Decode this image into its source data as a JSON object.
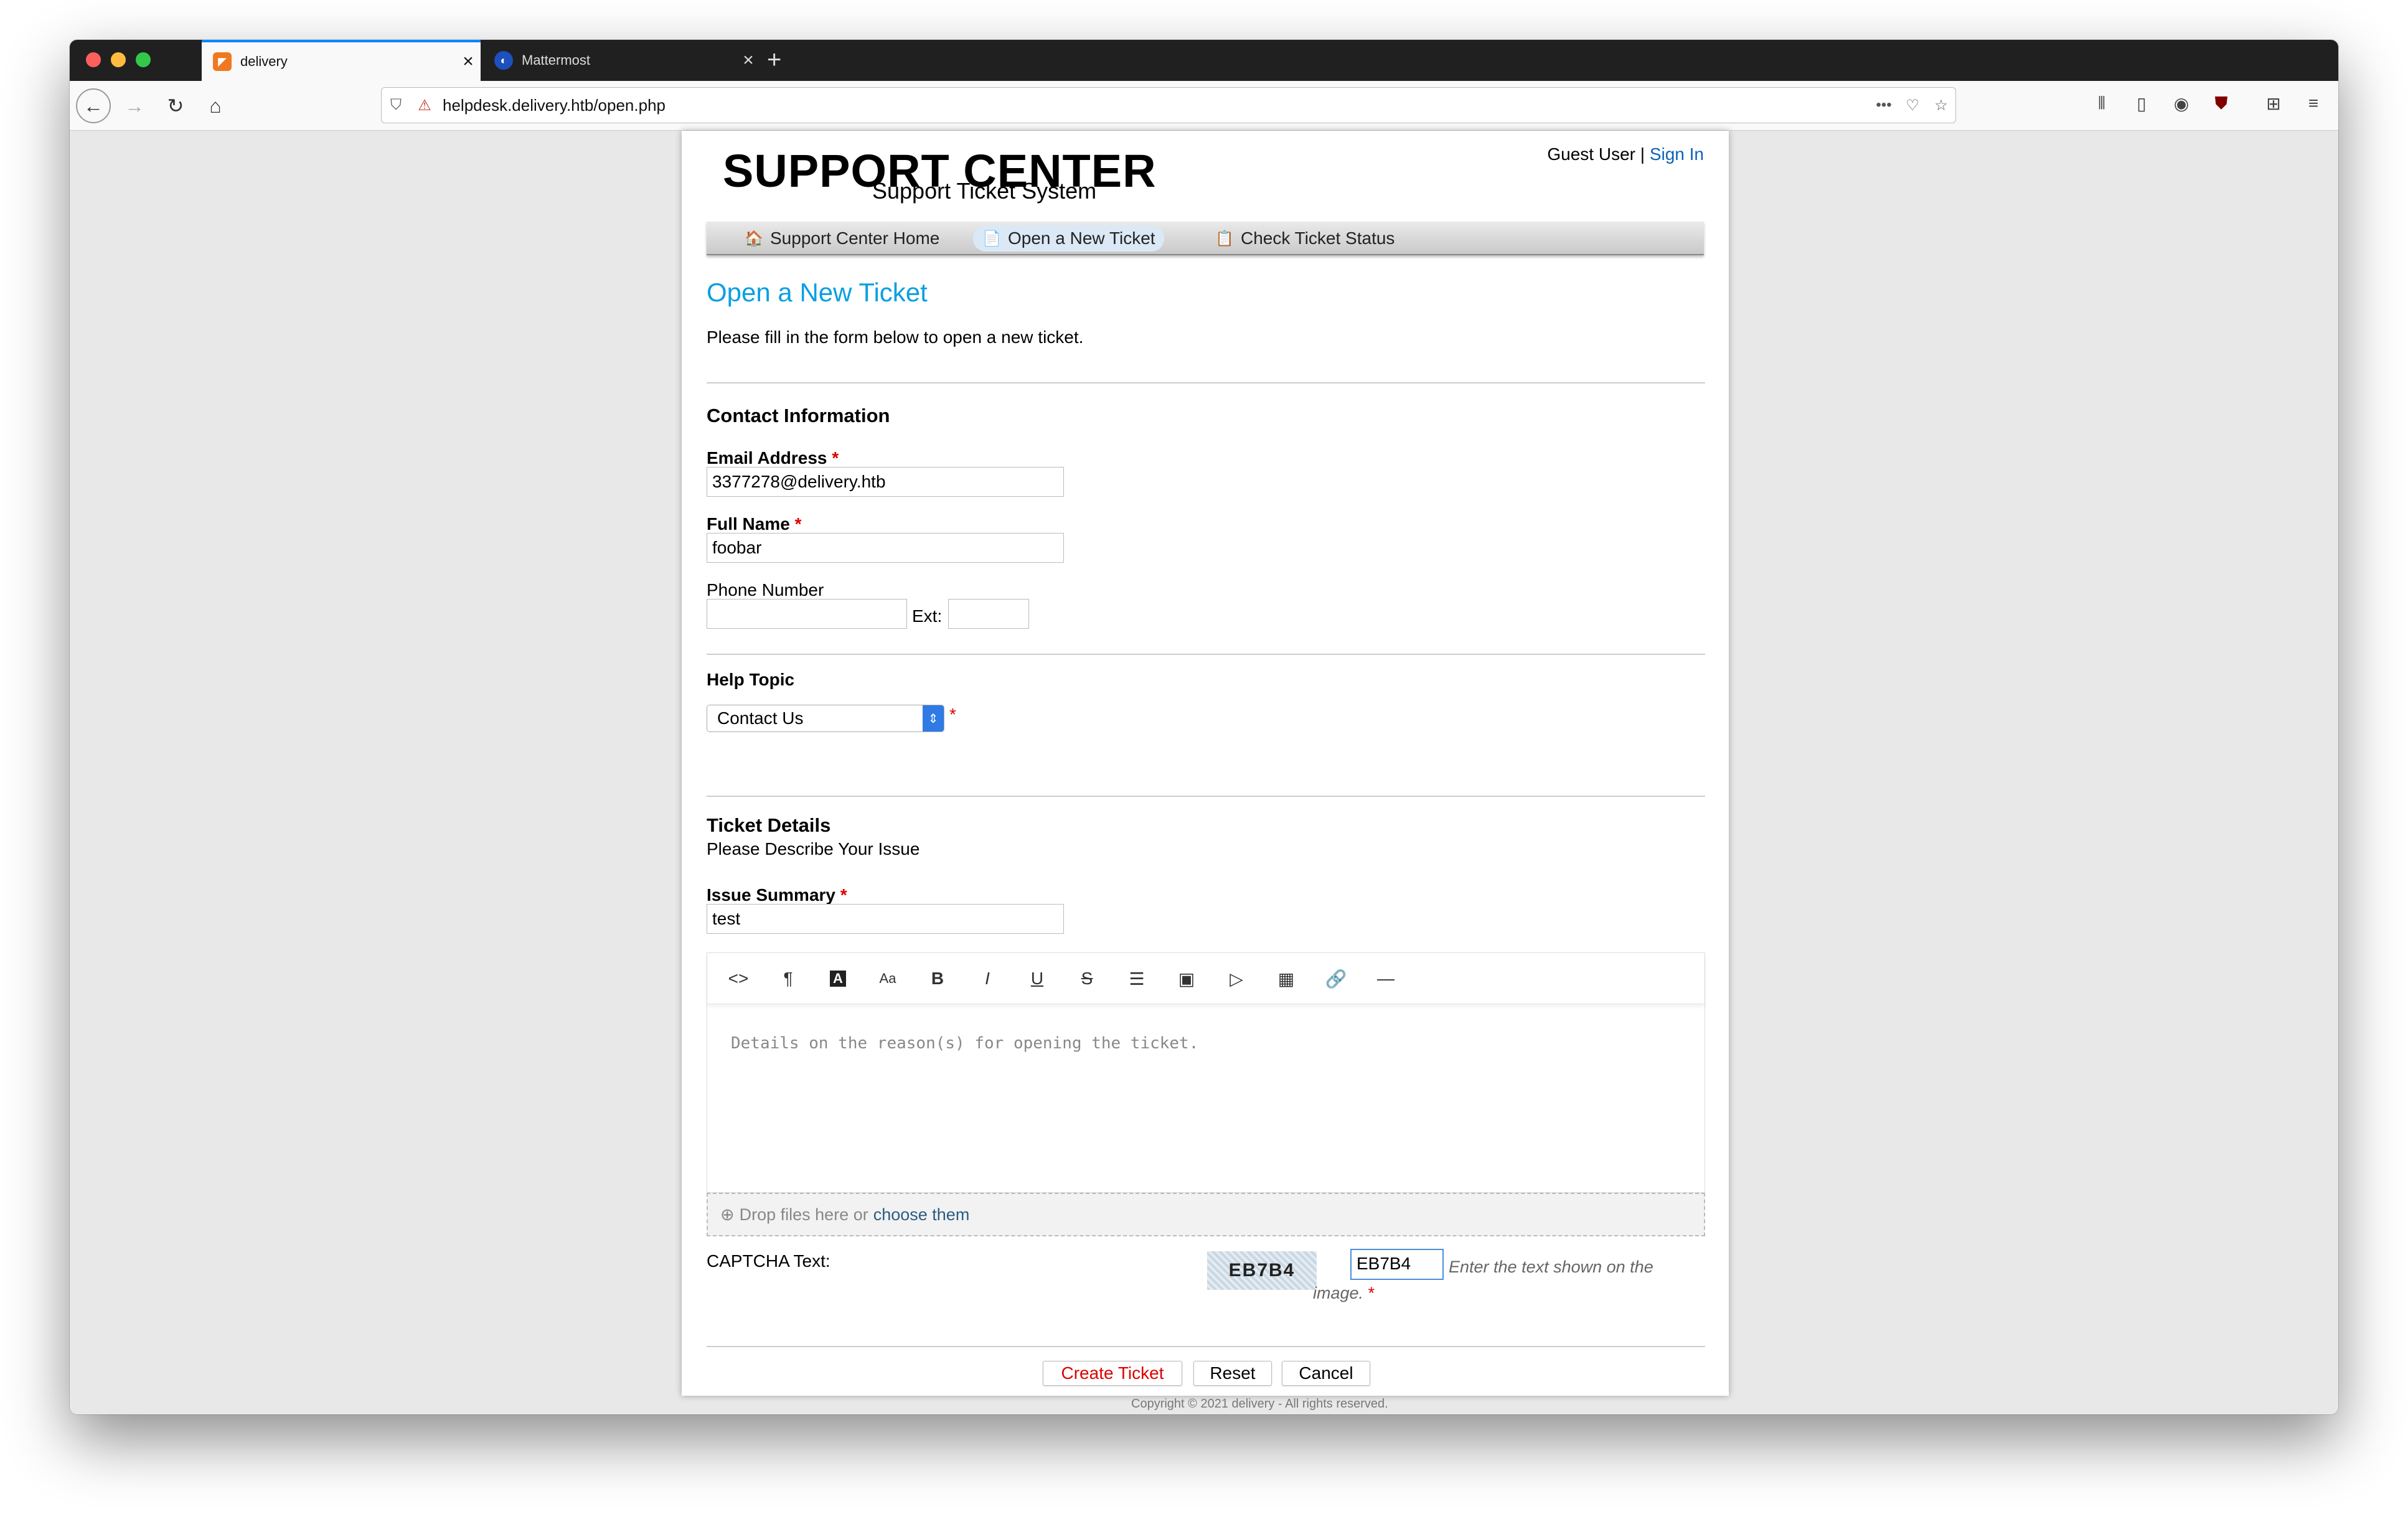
{
  "browser": {
    "tabs": [
      {
        "title": "delivery",
        "active": true
      },
      {
        "title": "Mattermost",
        "active": false
      }
    ],
    "url": "helpdesk.delivery.htb/open.php",
    "colors": {
      "accent": "#0a84ff",
      "tabstrip": "#202020"
    }
  },
  "header": {
    "logo_main": "SUPPORT CENTER",
    "logo_sub": "Support Ticket System",
    "guest": "Guest User",
    "separator": "|",
    "sign_in": "Sign In"
  },
  "nav": {
    "items": [
      {
        "label": "Support Center Home",
        "icon": "home-icon"
      },
      {
        "label": "Open a New Ticket",
        "icon": "new-ticket-icon"
      },
      {
        "label": "Check Ticket Status",
        "icon": "ticket-status-icon"
      }
    ]
  },
  "page": {
    "title": "Open a New Ticket",
    "intro": "Please fill in the form below to open a new ticket.",
    "title_color": "#0a9fe0"
  },
  "contact": {
    "heading": "Contact Information",
    "email_label": "Email Address",
    "email_value": "3377278@delivery.htb",
    "name_label": "Full Name",
    "name_value": "foobar",
    "phone_label": "Phone Number",
    "phone_value": "",
    "ext_label": "Ext:",
    "ext_value": ""
  },
  "help_topic": {
    "heading": "Help Topic",
    "selected": "Contact Us"
  },
  "ticket": {
    "heading": "Ticket Details",
    "subheading": "Please Describe Your Issue",
    "summary_label": "Issue Summary",
    "summary_value": "test",
    "details_placeholder": "Details on the reason(s) for opening the ticket.",
    "toolbar": [
      "code-view",
      "paragraph",
      "text-color",
      "font-size",
      "bold",
      "italic",
      "underline",
      "strikethrough",
      "list",
      "image",
      "video",
      "table",
      "link",
      "horizontal-rule"
    ],
    "drop_text": "Drop files here or",
    "drop_link": "choose them"
  },
  "captcha": {
    "label": "CAPTCHA Text:",
    "image_text": "EB7B4",
    "value": "EB7B4",
    "hint": "Enter the text shown on the image."
  },
  "buttons": {
    "create": "Create Ticket",
    "reset": "Reset",
    "cancel": "Cancel"
  },
  "footer": "Copyright © 2021 delivery - All rights reserved."
}
